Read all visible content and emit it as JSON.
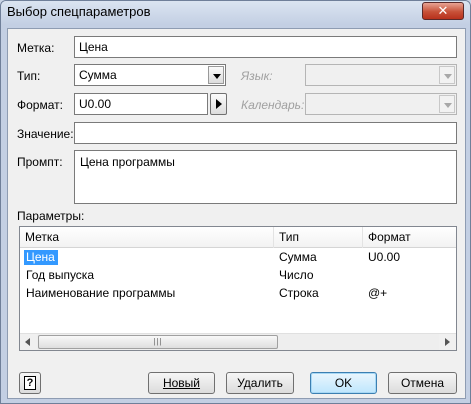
{
  "window": {
    "title": "Выбор спецпараметров",
    "close_glyph": "✕"
  },
  "form": {
    "label_caption": "Метка:",
    "label_value": "Цена",
    "type_caption": "Тип:",
    "type_value": "Сумма",
    "format_caption": "Формат:",
    "format_value": "U0.00",
    "language_caption": "Язык:",
    "language_value": "",
    "calendar_caption": "Календарь:",
    "calendar_value": "",
    "value_caption": "Значение:",
    "value_value": "",
    "prompt_caption": "Промпт:",
    "prompt_value": "Цена программы",
    "params_caption": "Параметры:"
  },
  "table": {
    "columns": [
      "Метка",
      "Тип",
      "Формат"
    ],
    "rows": [
      {
        "label": "Цена",
        "type": "Сумма",
        "format": "U0.00",
        "selected": true
      },
      {
        "label": "Год выпуска",
        "type": "Число",
        "format": ""
      },
      {
        "label": "Наименование программы",
        "type": "Строка",
        "format": "@+"
      }
    ],
    "scroll_grip": "|||"
  },
  "buttons": {
    "help_glyph": "?",
    "new": "Новый",
    "delete": "Удалить",
    "ok": "OK",
    "cancel": "Отмена"
  },
  "icons": {
    "help": "help-icon",
    "combo_arrow": "chevron-down-icon",
    "side_button": "triangle-right-icon",
    "close": "close-icon"
  },
  "colors": {
    "selection": "#3399ff",
    "close_button": "#c75138",
    "accent_default_button": "#3c7fb1"
  }
}
